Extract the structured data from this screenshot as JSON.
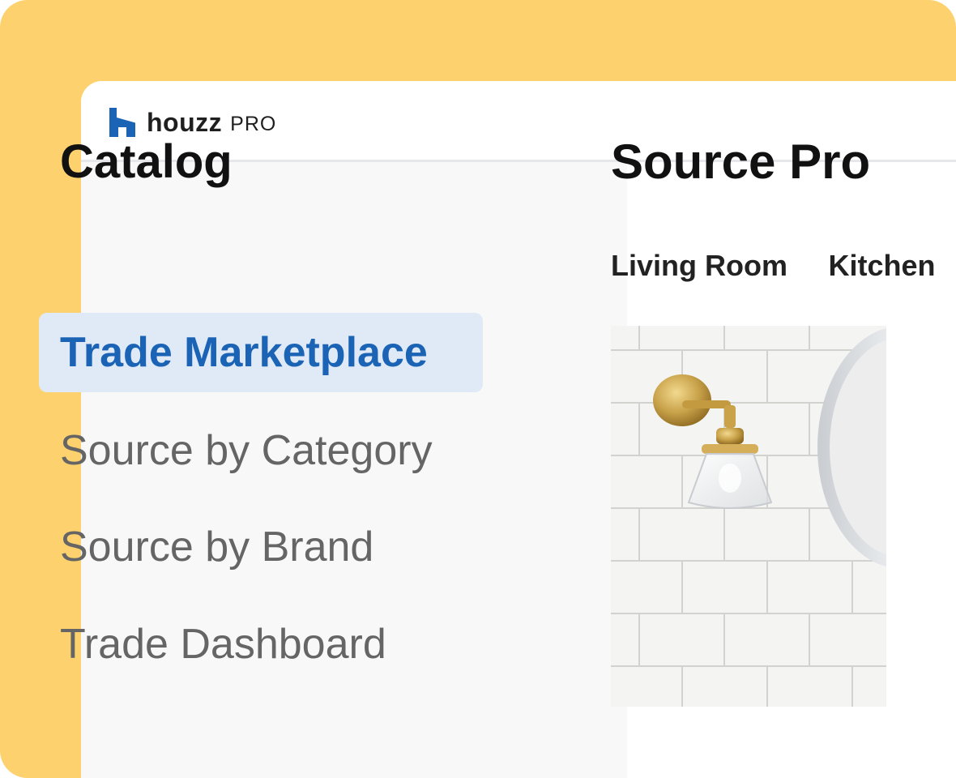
{
  "header": {
    "brand_word": "houzz",
    "brand_suffix": "PRO"
  },
  "sidebar": {
    "title": "Catalog",
    "items": [
      {
        "label": "Trade Marketplace",
        "active": true
      },
      {
        "label": "Source by Category",
        "active": false
      },
      {
        "label": "Source by Brand",
        "active": false
      },
      {
        "label": "Trade Dashboard",
        "active": false
      }
    ]
  },
  "main": {
    "title": "Source Pro",
    "tabs": [
      {
        "label": "Living Room"
      },
      {
        "label": "Kitchen"
      }
    ]
  },
  "colors": {
    "backdrop": "#fdd16d",
    "brand_blue": "#1a63b5",
    "active_bg": "#dfeaf6",
    "inactive_text": "#656565"
  }
}
